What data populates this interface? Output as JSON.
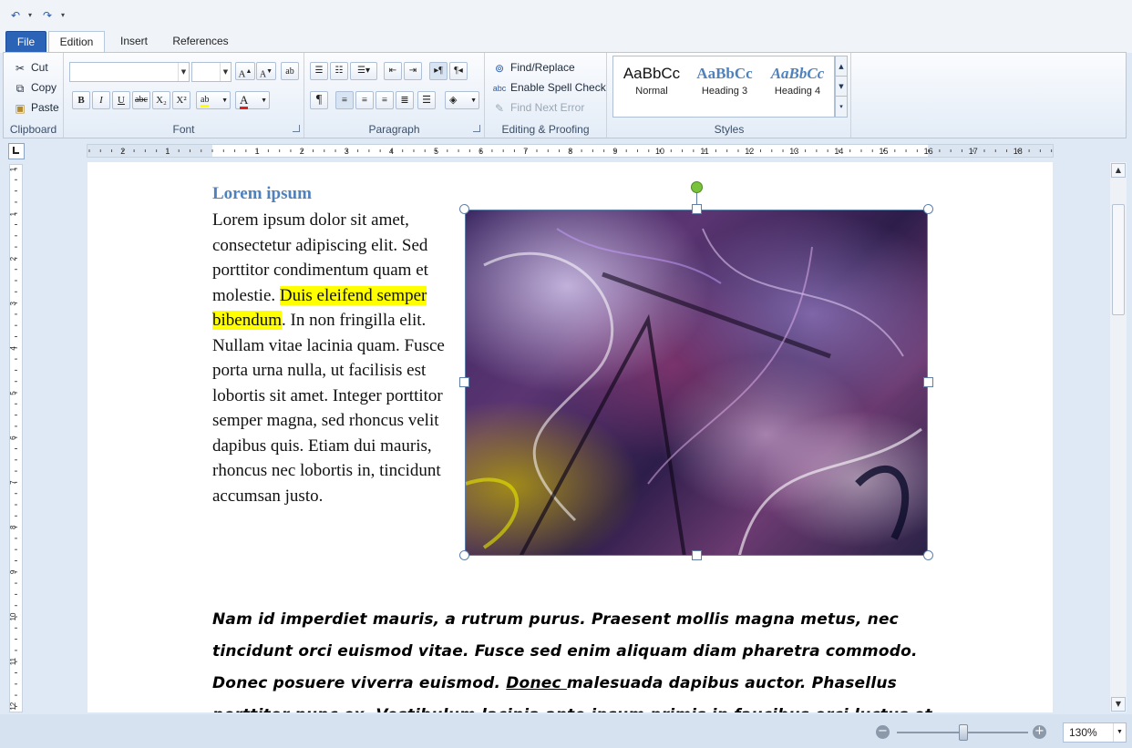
{
  "qat": {
    "undo": "↶",
    "redo": "↷",
    "dropdown": "▾"
  },
  "tabs": [
    {
      "label": "File"
    },
    {
      "label": "Edition"
    },
    {
      "label": "Insert"
    },
    {
      "label": "References"
    }
  ],
  "clipboard": {
    "cut": "Cut",
    "copy": "Copy",
    "paste": "Paste",
    "label": "Clipboard"
  },
  "font": {
    "name_value": "",
    "size_value": "",
    "grow": "A",
    "shrink": "A",
    "bold": "B",
    "italic": "I",
    "underline": "U",
    "strike": "abc",
    "subscript": "X₂",
    "superscript": "X²",
    "highlight": "ab",
    "fontcolor": "A",
    "label": "Font"
  },
  "paragraph": {
    "label": "Paragraph",
    "pilcrow": "¶"
  },
  "editing": {
    "find_replace": "Find/Replace",
    "spell_check": "Enable Spell Check",
    "find_next_error": "Find Next Error",
    "label": "Editing & Proofing"
  },
  "styles": {
    "items": [
      {
        "preview": "AaBbCc",
        "name": "Normal"
      },
      {
        "preview": "AaBbCc",
        "name": "Heading 3"
      },
      {
        "preview": "AaBbCc",
        "name": "Heading 4"
      }
    ],
    "label": "Styles"
  },
  "ruler": {
    "h_numbers": [
      "2",
      "1",
      "1",
      "2",
      "3",
      "4",
      "5",
      "6",
      "7",
      "8",
      "9",
      "10",
      "11",
      "12",
      "13",
      "14",
      "15",
      "16",
      "17",
      "18"
    ],
    "v_numbers": [
      "1",
      "1",
      "2",
      "3",
      "4",
      "5",
      "6",
      "7",
      "8",
      "9",
      "10",
      "11",
      "12"
    ]
  },
  "document": {
    "heading": "Lorem ipsum",
    "para1_before": "Lorem ipsum dolor sit amet, consectetur adipiscing elit. Sed porttitor condimentum quam et molestie. ",
    "para1_highlight": "Duis eleifend semper bibendum",
    "para1_after": ". In non fringilla elit. Nullam vitae lacinia quam. Fusce porta urna nulla, ut facilisis est lobortis sit amet. Integer porttitor semper magna, sed rhoncus velit dapibus quis. Etiam dui mauris, rhoncus nec lobortis in, tincidunt accumsan justo.",
    "para2_before": "Nam id imperdiet mauris, a rutrum purus. Praesent mollis magna metus, nec tincidunt orci euismod vitae. Fusce sed enim aliquam diam pharetra commodo. Donec posuere viverra euismod. ",
    "para2_underline": "Donec ",
    "para2_after": "malesuada dapibus auctor. Phasellus porttitor nunc ex. Vestibulum lacinia ante ipsum primis in faucibus orci luctus et ultrices posuere"
  },
  "status": {
    "zoom": "130%",
    "minus": "−",
    "plus": "+"
  }
}
